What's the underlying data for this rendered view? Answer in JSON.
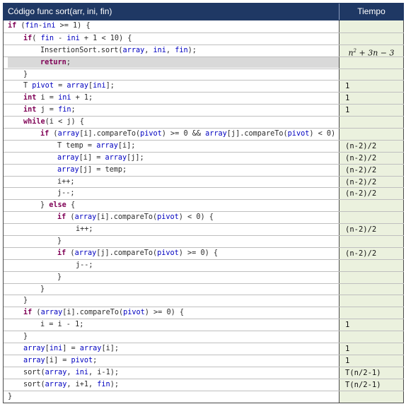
{
  "header": {
    "code_col": "Código func sort(arr, ini, fin)",
    "time_col": "Tiempo"
  },
  "rows": [
    {
      "indent": 0,
      "code": "if (fin-ini >= 1) {",
      "time": ""
    },
    {
      "indent": 1,
      "code": "if( fin - ini + 1 < 10) {",
      "time": ""
    },
    {
      "indent": 2,
      "code": "InsertionSort.sort(array, ini, fin);",
      "time": "n^2 + 3n − 3",
      "math": true
    },
    {
      "indent": 2,
      "code": "return;",
      "time": "",
      "highlight": true
    },
    {
      "indent": 1,
      "code": "}",
      "time": ""
    },
    {
      "indent": 1,
      "code": "T pivot = array[ini];",
      "time": "1"
    },
    {
      "indent": 1,
      "code": "int i = ini + 1;",
      "time": "1"
    },
    {
      "indent": 1,
      "code": "int j = fin;",
      "time": "1"
    },
    {
      "indent": 1,
      "code": "while(i < j) {",
      "time": ""
    },
    {
      "indent": 2,
      "code": "if (array[i].compareTo(pivot) >= 0 && array[j].compareTo(pivot) < 0) {",
      "time": ""
    },
    {
      "indent": 3,
      "code": "T temp = array[i];",
      "time": "(n-2)/2"
    },
    {
      "indent": 3,
      "code": "array[i] = array[j];",
      "time": "(n-2)/2"
    },
    {
      "indent": 3,
      "code": "array[j] = temp;",
      "time": "(n-2)/2"
    },
    {
      "indent": 3,
      "code": "i++;",
      "time": "(n-2)/2"
    },
    {
      "indent": 3,
      "code": "j--;",
      "time": "(n-2)/2"
    },
    {
      "indent": 2,
      "code": "} else {",
      "time": ""
    },
    {
      "indent": 3,
      "code": "if (array[i].compareTo(pivot) < 0) {",
      "time": ""
    },
    {
      "indent": 4,
      "code": "i++;",
      "time": "(n-2)/2"
    },
    {
      "indent": 3,
      "code": "}",
      "time": ""
    },
    {
      "indent": 3,
      "code": "if (array[j].compareTo(pivot) >= 0) {",
      "time": "(n-2)/2"
    },
    {
      "indent": 4,
      "code": "j--;",
      "time": ""
    },
    {
      "indent": 3,
      "code": "}",
      "time": ""
    },
    {
      "indent": 2,
      "code": "}",
      "time": ""
    },
    {
      "indent": 1,
      "code": "}",
      "time": ""
    },
    {
      "indent": 1,
      "code": "if (array[i].compareTo(pivot) >= 0) {",
      "time": ""
    },
    {
      "indent": 2,
      "code": "i = i - 1;",
      "time": "1"
    },
    {
      "indent": 1,
      "code": "}",
      "time": ""
    },
    {
      "indent": 1,
      "code": "array[ini] = array[i];",
      "time": "1"
    },
    {
      "indent": 1,
      "code": "array[i] = pivot;",
      "time": "1"
    },
    {
      "indent": 1,
      "code": "sort(array, ini, i-1);",
      "time": "T(n/2-1)"
    },
    {
      "indent": 1,
      "code": "sort(array, i+1, fin);",
      "time": "T(n/2-1)"
    },
    {
      "indent": 0,
      "code": "}",
      "time": ""
    }
  ]
}
